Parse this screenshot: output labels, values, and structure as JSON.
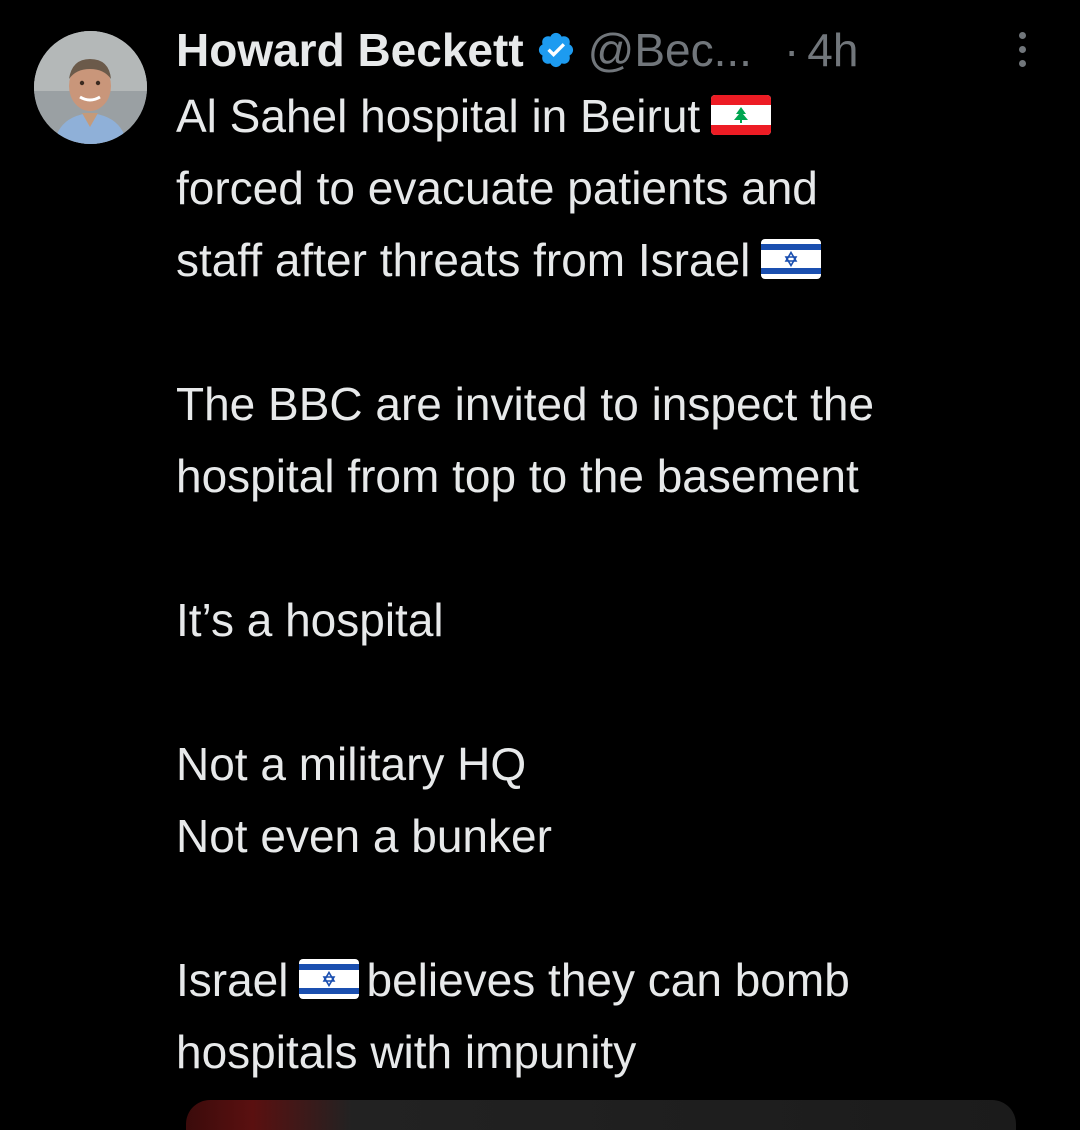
{
  "author": {
    "name": "Howard Beckett",
    "handle": "@Bec...",
    "separator": "·",
    "time": "4h",
    "verified": true
  },
  "tweet": {
    "line1_a": "Al Sahel hospital in Beirut",
    "line2": "forced to evacuate patients and",
    "line3_a": "staff after threats from Israel",
    "line4": "The BBC are invited to inspect the",
    "line5": "hospital from top to the basement",
    "line6": "It’s a hospital",
    "line7": "Not a military HQ",
    "line8": "Not even a bunker",
    "line9_a": "Israel",
    "line9_b": "believes they can bomb",
    "line10": "hospitals with impunity"
  },
  "icons": {
    "verified": "verified-badge-icon",
    "more": "more-options-icon",
    "flag_lebanon": "lebanon-flag-icon",
    "flag_israel": "israel-flag-icon"
  },
  "colors": {
    "background": "#000000",
    "text": "#e7e9ea",
    "secondary": "#71767b",
    "verified_blue": "#1d9bf0"
  }
}
